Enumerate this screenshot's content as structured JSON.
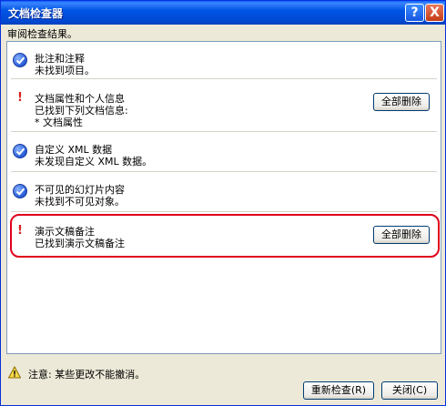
{
  "window": {
    "title": "文档检查器",
    "help_glyph": "?",
    "close_glyph": "X"
  },
  "subtitle": "审阅检查结果。",
  "items": [
    {
      "status": "ok",
      "icon": "check-circle-icon",
      "title": "批注和注释",
      "detail": "未找到项目。"
    },
    {
      "status": "found",
      "icon": "warning-exclamation-icon",
      "title": "文档属性和个人信息",
      "detail": "已找到下列文档信息:",
      "detail2": "* 文档属性",
      "button": "全部删除"
    },
    {
      "status": "ok",
      "icon": "check-circle-icon",
      "title": "自定义 XML 数据",
      "detail": "未发现自定义 XML 数据。"
    },
    {
      "status": "ok",
      "icon": "check-circle-icon",
      "title": "不可见的幻灯片内容",
      "detail": "未找到不可见对象。"
    },
    {
      "status": "found",
      "icon": "warning-exclamation-icon",
      "title": "演示文稿备注",
      "detail": "已找到演示文稿备注",
      "button": "全部删除"
    }
  ],
  "footer": {
    "note": "注意: 某些更改不能撤消。",
    "recheck_button": "重新检查(R)",
    "close_button": "关闭(C)"
  },
  "colors": {
    "highlight": "#e0001b",
    "titlebar": "#0055e5",
    "check": "#2459d6",
    "warning": "#d42020"
  }
}
